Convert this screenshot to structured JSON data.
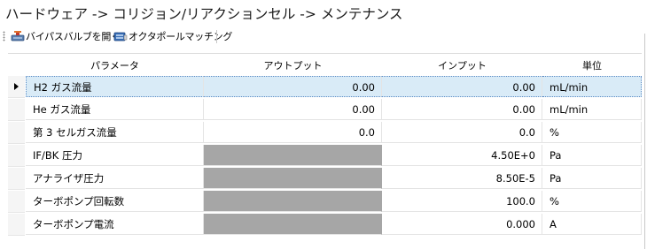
{
  "page": {
    "title": "ハードウェア -> コリジョン/リアクションセル -> メンテナンス"
  },
  "toolbar": {
    "bypass_label": "バイパスバルブを開く",
    "bypass_icon": "valve-open-icon",
    "octa_label": "オクタポールマッチング",
    "octa_icon": "octapole-matching-icon"
  },
  "table": {
    "columns": {
      "parameter": "パラメータ",
      "output": "アウトプット",
      "input": "インプット",
      "unit": "単位"
    },
    "selected_row": 0,
    "rows": [
      {
        "parameter": "H2 ガス流量",
        "output": "0.00",
        "input": "0.00",
        "unit": "mL/min",
        "output_available": true
      },
      {
        "parameter": "He ガス流量",
        "output": "0.00",
        "input": "0.00",
        "unit": "mL/min",
        "output_available": true
      },
      {
        "parameter": "第 3 セルガス流量",
        "output": "0.0",
        "input": "0.0",
        "unit": "%",
        "output_available": true
      },
      {
        "parameter": "IF/BK 圧力",
        "output": "",
        "input": "4.50E+0",
        "unit": "Pa",
        "output_available": false
      },
      {
        "parameter": "アナライザ圧力",
        "output": "",
        "input": "8.50E-5",
        "unit": "Pa",
        "output_available": false
      },
      {
        "parameter": "ターボポンプ回転数",
        "output": "",
        "input": "100.0",
        "unit": "%",
        "output_available": false
      },
      {
        "parameter": "ターボポンプ電流",
        "output": "",
        "input": "0.000",
        "unit": "A",
        "output_available": false
      }
    ]
  },
  "colors": {
    "selected_row_bg": "#d9ebf7",
    "disabled_cell_bg": "#a6a6a6"
  }
}
